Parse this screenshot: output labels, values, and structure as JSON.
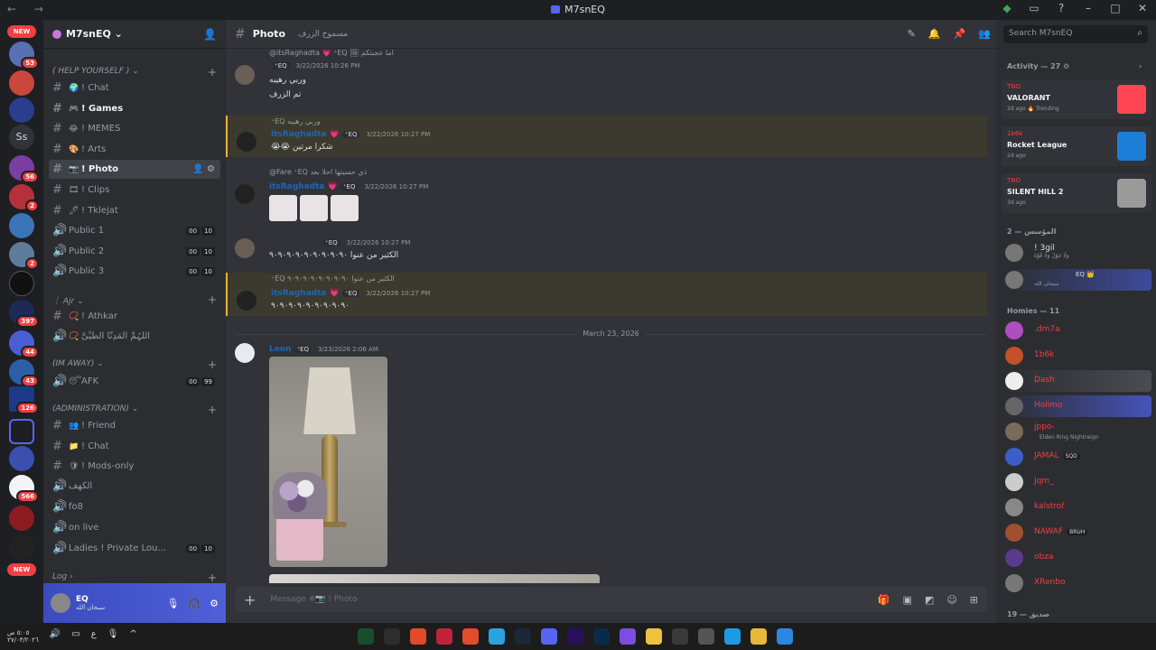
{
  "window": {
    "title": "M7snEQ",
    "nav": "← →"
  },
  "servers": {
    "new_top": "NEW",
    "new_bottom": "NEW",
    "letters": "Ss",
    "badges": [
      "53",
      "56",
      "2",
      "2",
      "397",
      "44",
      "43",
      "126",
      "566"
    ]
  },
  "guild": {
    "name": "M7snEQ ⌄"
  },
  "categories": {
    "help": "( HELP YOURSELF ) ⌄",
    "ajr": "｜ Ajr ⌄",
    "away": "(IM AWAY) ⌄",
    "admin": "(ADMINISTRATION) ⌄",
    "log": "Log ›"
  },
  "channels": [
    {
      "name": "! Chat",
      "icon": "#",
      "emo": "🌍"
    },
    {
      "name": "! Games",
      "icon": "#",
      "emo": "🎮"
    },
    {
      "name": "! MEMES",
      "icon": "#",
      "emo": "😂"
    },
    {
      "name": "! Arts",
      "icon": "#",
      "emo": "🎨"
    },
    {
      "name": "! Photo",
      "icon": "#",
      "emo": "📷"
    },
    {
      "name": "! Clips",
      "icon": "#",
      "emo": "🎞"
    },
    {
      "name": "! Tklejat",
      "icon": "#",
      "emo": "🖊"
    },
    {
      "name": "Public 1",
      "icon": "🔊",
      "c1": "00",
      "c2": "10"
    },
    {
      "name": "Public 2",
      "icon": "🔊",
      "c1": "00",
      "c2": "10"
    },
    {
      "name": "Public 3",
      "icon": "🔊",
      "c1": "00",
      "c2": "10"
    },
    {
      "name": "! Athkar",
      "icon": "#",
      "emo": "📿"
    },
    {
      "name": "اَللّٰہُمَّ اَلْمَدِنَّا الْطَّبِّیَّ",
      "icon": "🔊",
      "emo": "📿"
    },
    {
      "name": "AFK",
      "icon": "🔊",
      "emo": "😴",
      "c1": "00",
      "c2": "99"
    },
    {
      "name": "! Friend",
      "icon": "#",
      "emo": "👥"
    },
    {
      "name": "! Chat",
      "icon": "#",
      "emo": "📁"
    },
    {
      "name": "! Mods-only",
      "icon": "#",
      "emo": "🛡"
    },
    {
      "name": "الكهف",
      "icon": "🔊"
    },
    {
      "name": "fo8",
      "icon": "🔊"
    },
    {
      "name": "on live",
      "icon": "🔊"
    },
    {
      "name": "Ladies ! Private Lou...",
      "icon": "🔊",
      "c1": "00",
      "c2": "10"
    }
  ],
  "user": {
    "name": "EQ",
    "status": "سبحان الله"
  },
  "topbar": {
    "channel": "Photo",
    "topic": "مسموح الزرف"
  },
  "messages": [
    {
      "reply": "@itsRaghadta 💗 ⁺EQ 🖼 اما عجبتكم",
      "user": "",
      "tag": "⁺EQ",
      "time": "3/22/2026 10:26 PM",
      "lines": [
        "وربي رهيبه",
        "تم الزرف"
      ]
    },
    {
      "reply": "⁺EQ وربي رهيبه",
      "user": "itsRaghadta 💗",
      "tag": "⁺EQ",
      "time": "3/22/2026 10:27 PM",
      "lines": [
        "😭😭 شكرا مرتين"
      ]
    },
    {
      "reply": "@Fare ⁺EQ ذي حسيتها احلا بعد",
      "user": "itsRaghadta 💗",
      "tag": "⁺EQ",
      "time": "3/22/2026 10:27 PM",
      "lines": []
    },
    {
      "reply": "",
      "user": "",
      "tag": "⁺EQ",
      "time": "3/22/2026 10:27 PM",
      "lines": [
        "الكثير من عنوا ٩٠٩٠٩٠٩٠٩٠٩٠٩٠٩٠٩٠"
      ]
    },
    {
      "reply": "⁺EQ الكثير من عنوا ٩٠٩٠٩٠٩٠٩٠٩٠٩٠٩٠",
      "user": "itsRaghadta 💗",
      "tag": "⁺EQ",
      "time": "3/22/2026 10:27 PM",
      "lines": [
        "٩٠٩٠٩٠٩٠٩٠٩٠٩٠٩٠٩٠"
      ]
    },
    {
      "reply": "",
      "user": "Leen",
      "tag": "⁺EQ",
      "time": "3/23/2026 2:06 AM",
      "lines": []
    }
  ],
  "date_divider": "March 23, 2026",
  "composer": {
    "placeholder": "Message #📷 ! Photo"
  },
  "members": {
    "search_placeholder": "Search M7snEQ",
    "activity_title": "Activity — 27",
    "activities": [
      {
        "who": "TNO",
        "game": "VALORANT",
        "ago": "2d ago  🔥 Trending",
        "color": "#ff4655"
      },
      {
        "who": "1b6k",
        "game": "Rocket League",
        "ago": "2d ago",
        "color": "#1b7fd8"
      },
      {
        "who": "TNO",
        "game": "SILENT HILL 2",
        "ago": "3d ago",
        "color": "#9a9a9a"
      }
    ],
    "founders": "المؤسس — 2",
    "founder_list": [
      {
        "name": "! 3gil",
        "status": "وَلَا حَوْلَ وَلَا قُوَّةَ"
      },
      {
        "name": "EQ 👑",
        "status": "سبحان الله"
      }
    ],
    "homies": "Homies — 11",
    "homie_list": [
      {
        "name": ".dm7a",
        "status": "",
        "tag": ""
      },
      {
        "name": "1b6k",
        "status": "",
        "tag": ""
      },
      {
        "name": "Dash",
        "status": "",
        "tag": ""
      },
      {
        "name": "Holimo",
        "status": "",
        "tag": ""
      },
      {
        "name": "jppo-",
        "status": "Elden Ring Nightreign",
        "tag": ""
      },
      {
        "name": "JAMAL",
        "status": "",
        "tag": "SQD"
      },
      {
        "name": "Jqm_",
        "status": "",
        "tag": ""
      },
      {
        "name": "kalstrof",
        "status": "",
        "tag": ""
      },
      {
        "name": "NAWAF",
        "status": "",
        "tag": "BRUH"
      },
      {
        "name": "obza",
        "status": "",
        "tag": ""
      },
      {
        "name": "XRenbo",
        "status": "",
        "tag": ""
      }
    ],
    "friends": "صديق — 19"
  },
  "taskbar": {
    "clock": "٥:٠٥ ص",
    "date": "٢٧/٠٣/٢٠٢٦",
    "lang": "ع"
  }
}
